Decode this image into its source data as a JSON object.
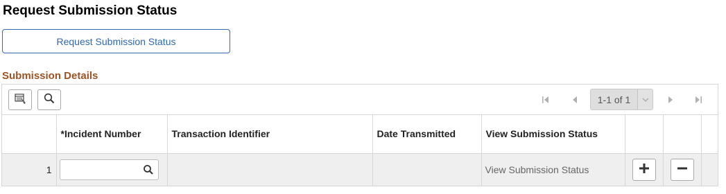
{
  "page": {
    "title": "Request Submission Status",
    "request_button_label": "Request Submission Status"
  },
  "section": {
    "title": "Submission Details"
  },
  "toolbar": {
    "icons": [
      "personalize-grid-icon",
      "search-icon"
    ],
    "pager": {
      "value": "1-1 of 1",
      "icons": [
        "first-page-icon",
        "previous-page-icon",
        "next-page-icon",
        "last-page-icon"
      ]
    }
  },
  "grid": {
    "columns": [
      "",
      "*Incident Number",
      "Transaction Identifier",
      "Date Transmitted",
      "View Submission Status",
      "",
      "",
      ""
    ],
    "rows": [
      {
        "row_number": "1",
        "incident_number": "",
        "transaction_identifier": "",
        "date_transmitted": "",
        "view_status_link": "View Submission Status"
      }
    ]
  },
  "colors": {
    "accent_blue": "#2d68b1",
    "section_brown": "#9b5323",
    "row_background": "#efefef"
  }
}
